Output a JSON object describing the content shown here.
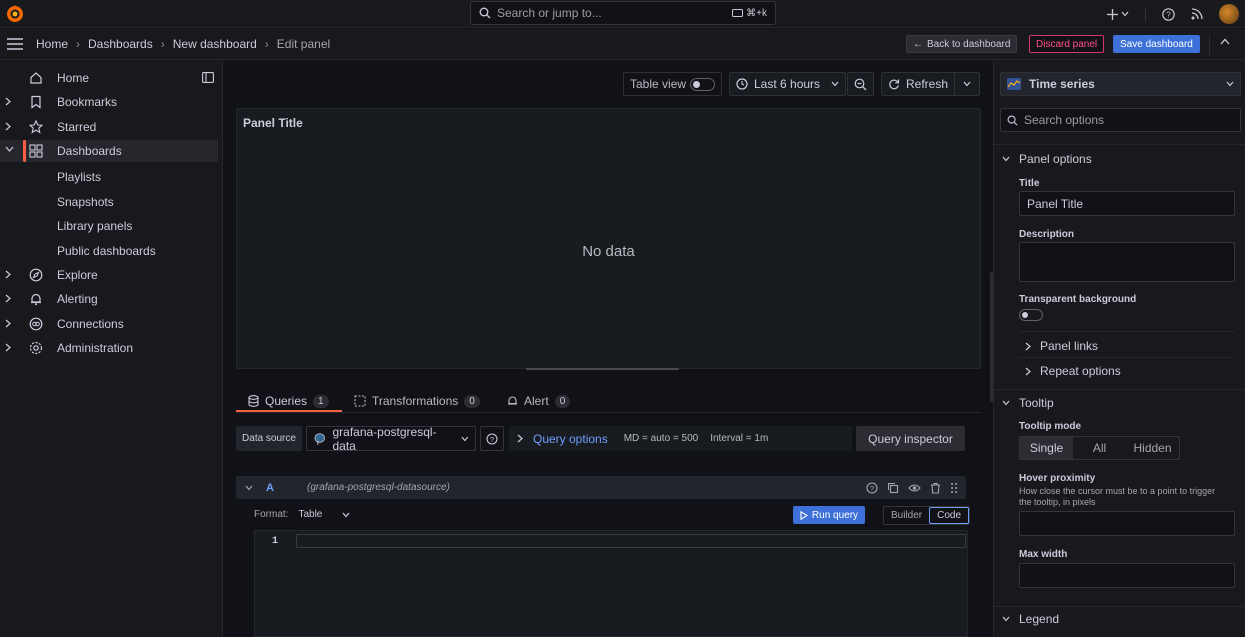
{
  "topbar": {
    "search_placeholder": "Search or jump to...",
    "search_shortcut": "⌘+k"
  },
  "breadcrumb": {
    "items": [
      "Home",
      "Dashboards",
      "New dashboard",
      "Edit panel"
    ]
  },
  "actions": {
    "back": "Back to dashboard",
    "discard": "Discard panel",
    "save": "Save dashboard"
  },
  "sidebar": {
    "items": [
      {
        "label": "Home",
        "icon": "home-icon"
      },
      {
        "label": "Bookmarks",
        "icon": "bookmark-icon"
      },
      {
        "label": "Starred",
        "icon": "star-icon"
      },
      {
        "label": "Dashboards",
        "icon": "apps-icon"
      },
      {
        "label": "Explore",
        "icon": "compass-icon"
      },
      {
        "label": "Alerting",
        "icon": "bell-icon"
      },
      {
        "label": "Connections",
        "icon": "link-icon"
      },
      {
        "label": "Administration",
        "icon": "cog-icon"
      }
    ],
    "dashboard_children": [
      "Playlists",
      "Snapshots",
      "Library panels",
      "Public dashboards"
    ]
  },
  "toolbar": {
    "table_view": "Table view",
    "time_range": "Last 6 hours",
    "refresh": "Refresh"
  },
  "panel": {
    "title": "Panel Title",
    "empty_text": "No data"
  },
  "tabs": [
    {
      "label": "Queries",
      "count": "1"
    },
    {
      "label": "Transformations",
      "count": "0"
    },
    {
      "label": "Alert",
      "count": "0"
    }
  ],
  "query_bar": {
    "ds_label": "Data source",
    "ds_value": "grafana-postgresql-data",
    "options_label": "Query options",
    "md": "MD = auto = 500",
    "interval": "Interval = 1m",
    "inspector": "Query inspector"
  },
  "query_row": {
    "letter": "A",
    "datasource": "(grafana-postgresql-datasource)",
    "format_label": "Format:",
    "format_value": "Table",
    "run": "Run query",
    "builder": "Builder",
    "code": "Code",
    "line_number": "1"
  },
  "options": {
    "viz": "Time series",
    "search_placeholder": "Search options",
    "panel_options": "Panel options",
    "title_label": "Title",
    "title_value": "Panel Title",
    "description_label": "Description",
    "transparent_label": "Transparent background",
    "panel_links": "Panel links",
    "repeat_options": "Repeat options",
    "tooltip": "Tooltip",
    "tooltip_mode_label": "Tooltip mode",
    "tooltip_modes": [
      "Single",
      "All",
      "Hidden"
    ],
    "hover_label": "Hover proximity",
    "hover_desc": "How close the cursor must be to a point to trigger the tooltip, in pixels",
    "max_width_label": "Max width",
    "legend": "Legend"
  },
  "colors": {
    "accent": "#f55f3e",
    "primary": "#3d71d9",
    "link": "#6e9fff",
    "danger": "#d4366a"
  }
}
